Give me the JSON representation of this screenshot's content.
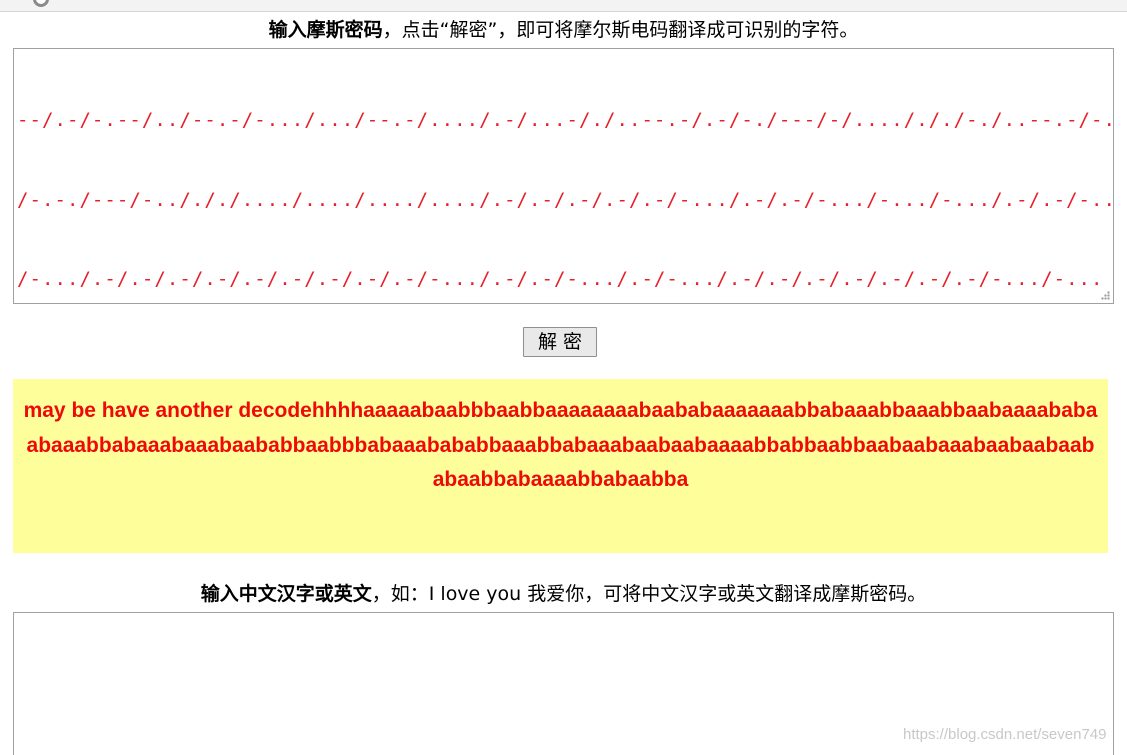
{
  "instruction1": {
    "bold": "输入摩斯密码",
    "rest": "，点击“解密”，即可将摩尔斯电码翻译成可识别的字符。"
  },
  "morse_input": {
    "lines": [
      "--/.-/-.--/../--.-/-.../.../--.-/..../.-/...-/./..--.-/.-/-./---/-/..../././-./..--.-/-../.",
      "/-.-./---/-../././..../..../..../..../.-/.-/.-/.-/.-/-.../.-/.-/-.../-.../-.../.-/.-/-...",
      "/-.../.-/.-/.-/.-/.-/.-/.-/.-/.-/-.../.-/.-/-.../.-/-.../.-/.-/.-/.-/.-/.-/.-/-.../-...",
      "/.-/-.../.-/.-/.-/-.../-.../.-/.-/.-/-.../-.../.-/.-/-.../.-/.-/.-/.-/-.../.-/-.../.-/.-",
      "/-.../.-/.-/.-/-.../-.../.-/-.../.-/.-/.-/-.../.-/.-/.-/-.../.-/.-/-.../.-/-.../-.../.-/.-",
      "/-.../-.../-.../.-/-.../.-/.-/.-/-.../.-/.-/.-/-.../.-/-.../-.../.-/.-/.-/-.../-.../.-/-.../.-",
      "/.-/.-/-.../.-/-.../.-/.-/-.../.-/.-/.-/.-/-.../-.../.-/-.../-.../.-/.-/-.../-.../.-/.-",
      "/-.../.-/.-/-.../.-/.-/.-/-.../.-/.-/-.../.-/.-/-.../.-/.-/-.../.-/-.../.-/.-/-.../-.../.-",
      "/-.../.-/.-/.-/.-/-.../-.../.-/-.../.-/.-/-.../-.../.-"
    ]
  },
  "decrypt_button": {
    "label": "解 密"
  },
  "result": {
    "text": "may be have another decodehhhhaaaaabaabbbaabbaaaaaaaabaababaaaaaaabbabaaabbaaabbaabaaaababaabaaabbabaaabaaabaababbaabbbabaaabababbaaabbabaaabaabaabaaaabbabbaabbaabaabaaabaabaabaababaabbabaaaabbabaabba"
  },
  "instruction2": {
    "bold": "输入中文汉字或英文",
    "rest": "，如：I love you 我爱你，可将中文汉字或英文翻译成摩斯密码。"
  },
  "text_input": {
    "value": ""
  },
  "watermark": "https://blog.csdn.net/seven749",
  "colors": {
    "morse_text": "#e5202a",
    "result_bg": "#fefe9b",
    "result_text": "#ee0a0a"
  }
}
